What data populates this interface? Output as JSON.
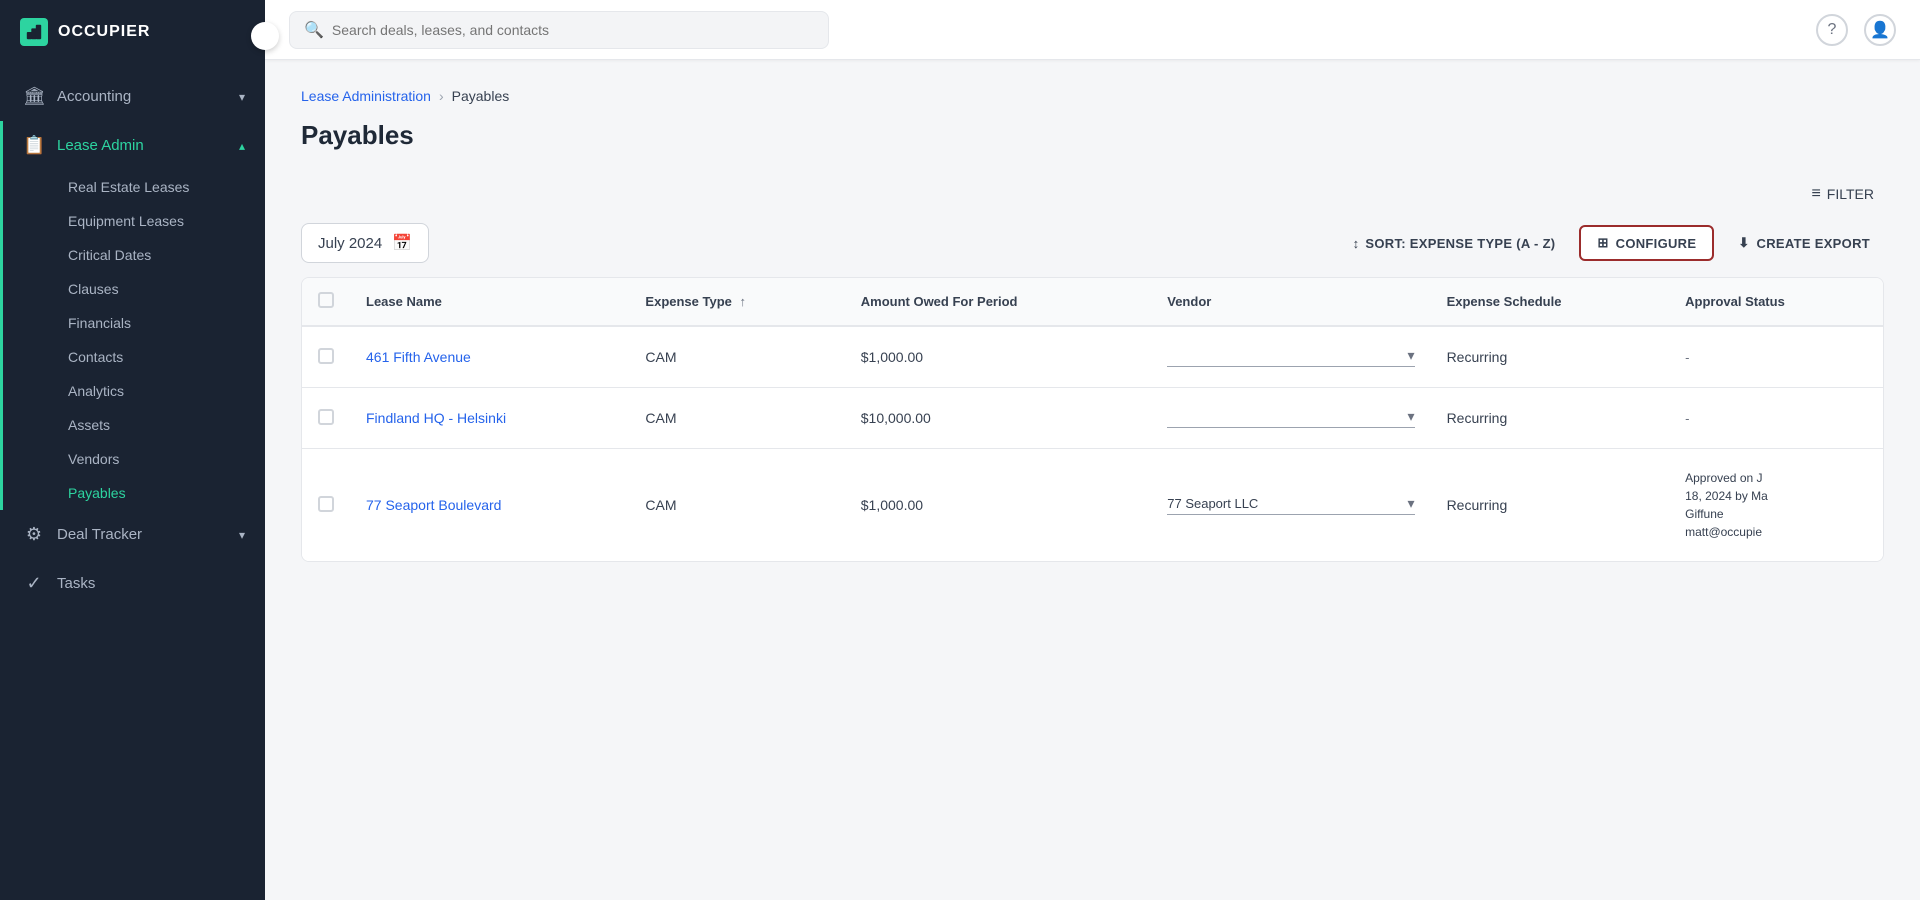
{
  "app": {
    "logo_text": "OCCUPIER",
    "logo_icon": "O"
  },
  "sidebar": {
    "collapse_icon": "❮",
    "sections": [
      {
        "id": "accounting",
        "label": "Accounting",
        "icon": "🏛",
        "expanded": false,
        "active": false,
        "chevron": "▾"
      },
      {
        "id": "lease-admin",
        "label": "Lease Admin",
        "icon": "📋",
        "expanded": true,
        "active": true,
        "chevron": "▴"
      },
      {
        "id": "deal-tracker",
        "label": "Deal Tracker",
        "icon": "⚙",
        "expanded": false,
        "active": false,
        "chevron": "▾"
      },
      {
        "id": "tasks",
        "label": "Tasks",
        "icon": "✓",
        "active": false
      }
    ],
    "lease_admin_subitems": [
      {
        "id": "real-estate-leases",
        "label": "Real Estate Leases",
        "active": false
      },
      {
        "id": "equipment-leases",
        "label": "Equipment Leases",
        "active": false
      },
      {
        "id": "critical-dates",
        "label": "Critical Dates",
        "active": false
      },
      {
        "id": "clauses",
        "label": "Clauses",
        "active": false
      },
      {
        "id": "financials",
        "label": "Financials",
        "active": false
      },
      {
        "id": "contacts",
        "label": "Contacts",
        "active": false
      },
      {
        "id": "analytics",
        "label": "Analytics",
        "active": false
      },
      {
        "id": "assets",
        "label": "Assets",
        "active": false
      },
      {
        "id": "vendors",
        "label": "Vendors",
        "active": false
      },
      {
        "id": "payables",
        "label": "Payables",
        "active": true
      }
    ]
  },
  "topbar": {
    "search_placeholder": "Search deals, leases, and contacts",
    "help_icon": "?",
    "user_icon": "👤"
  },
  "breadcrumb": {
    "parent": "Lease Administration",
    "separator": ">",
    "current": "Payables"
  },
  "page": {
    "title": "Payables"
  },
  "toolbar": {
    "filter_icon": "≡",
    "filter_label": "FILTER"
  },
  "controls": {
    "date_value": "July 2024",
    "date_icon": "📅",
    "sort_icon": "↕",
    "sort_label": "SORT: EXPENSE TYPE (A - Z)",
    "configure_icon": "⊞",
    "configure_label": "CONFIGURE",
    "export_icon": "⬇",
    "export_label": "CREATE EXPORT"
  },
  "table": {
    "columns": [
      {
        "id": "checkbox",
        "label": ""
      },
      {
        "id": "lease-name",
        "label": "Lease Name"
      },
      {
        "id": "expense-type",
        "label": "Expense Type",
        "sortable": true
      },
      {
        "id": "amount",
        "label": "Amount Owed For Period"
      },
      {
        "id": "vendor",
        "label": "Vendor"
      },
      {
        "id": "expense-schedule",
        "label": "Expense Schedule"
      },
      {
        "id": "approval-status",
        "label": "Approval Status"
      }
    ],
    "rows": [
      {
        "id": 1,
        "lease_name": "461 Fifth Avenue",
        "expense_type": "CAM",
        "amount": "$1,000.00",
        "vendor": "",
        "expense_schedule": "Recurring",
        "approval_status": "-"
      },
      {
        "id": 2,
        "lease_name": "Findland HQ - Helsinki",
        "expense_type": "CAM",
        "amount": "$10,000.00",
        "vendor": "",
        "expense_schedule": "Recurring",
        "approval_status": "-"
      },
      {
        "id": 3,
        "lease_name": "77 Seaport Boulevard",
        "expense_type": "CAM",
        "amount": "$1,000.00",
        "vendor": "77 Seaport LLC",
        "expense_schedule": "Recurring",
        "approval_status": "Approved on J\n18, 2024 by Ma\nGiffune\nmatt@occupie"
      }
    ]
  }
}
